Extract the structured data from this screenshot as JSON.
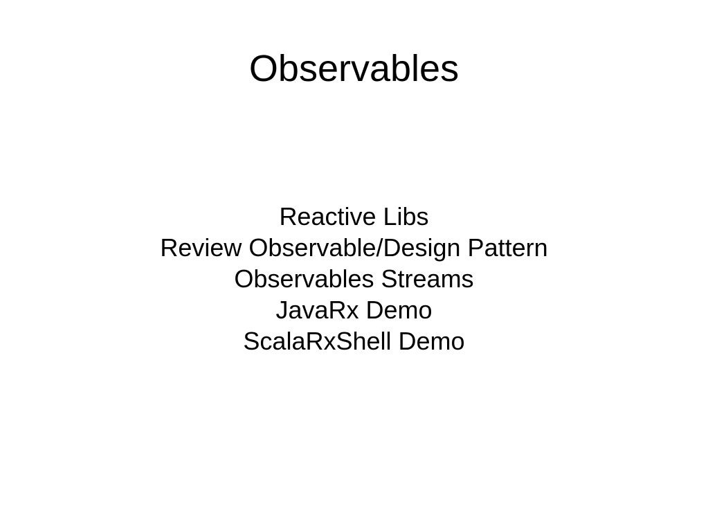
{
  "slide": {
    "title": "Observables",
    "lines": [
      "Reactive Libs",
      "Review Observable/Design Pattern",
      "Observables Streams",
      "JavaRx Demo",
      "ScalaRxShell Demo"
    ]
  }
}
